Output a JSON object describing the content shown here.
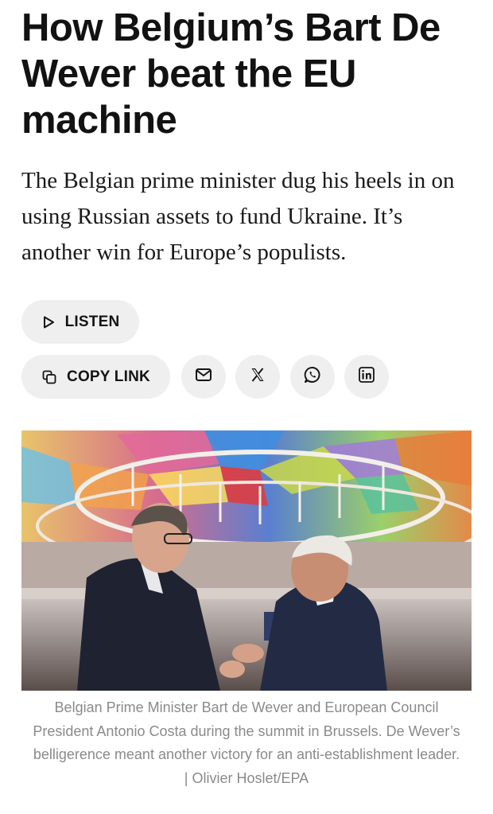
{
  "article": {
    "headline": "How Belgium’s Bart De Wever beat the EU machine",
    "dek": "The Belgian prime minister dug his heels in on using Russian assets to fund Ukraine. It’s another win for Europe’s populists."
  },
  "actions": {
    "listen_label": "LISTEN",
    "copy_link_label": "COPY LINK",
    "share_icons": [
      "mail-icon",
      "x-icon",
      "whatsapp-icon",
      "linkedin-icon"
    ]
  },
  "photo": {
    "caption": "Belgian Prime Minister Bart de Wever and European Council President Antonio Costa during the summit in Brussels. De Wever’s belligerence meant another victory for an anti-establishment leader. | Olivier Hoslet/EPA"
  },
  "colors": {
    "pill_background": "#efefef",
    "text": "#121212",
    "caption": "#8a8a8a"
  }
}
